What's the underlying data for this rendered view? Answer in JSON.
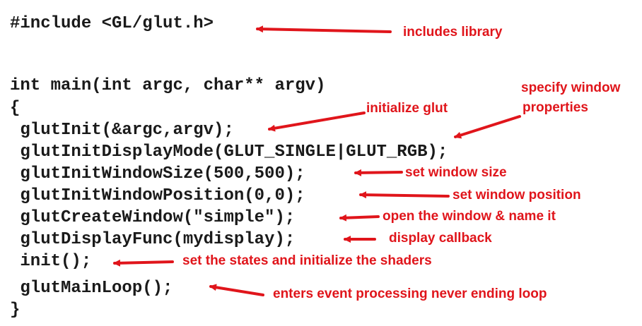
{
  "code_lines": [
    "#include <GL/glut.h>",
    "int main(int argc, char** argv)",
    "{",
    " glutInit(&argc,argv);",
    " glutInitDisplayMode(GLUT_SINGLE|GLUT_RGB);",
    " glutInitWindowSize(500,500);",
    " glutInitWindowPosition(0,0);",
    " glutCreateWindow(\"simple\");",
    " glutDisplayFunc(mydisplay);",
    " init();",
    " glutMainLoop();",
    "}"
  ],
  "annotations": {
    "includes": "includes library",
    "init_glut": "initialize glut",
    "window_props_1": "specify window",
    "window_props_2": "properties",
    "window_size": "set window size",
    "window_position": "set window position",
    "open_window": "open the window & name it",
    "display_callback": "display callback",
    "init_states": "set the states and initialize the shaders",
    "main_loop": "enters event processing never ending loop"
  },
  "colors": {
    "annotation": "#e0151b",
    "code": "#1a1a1a",
    "background": "#ffffff"
  }
}
